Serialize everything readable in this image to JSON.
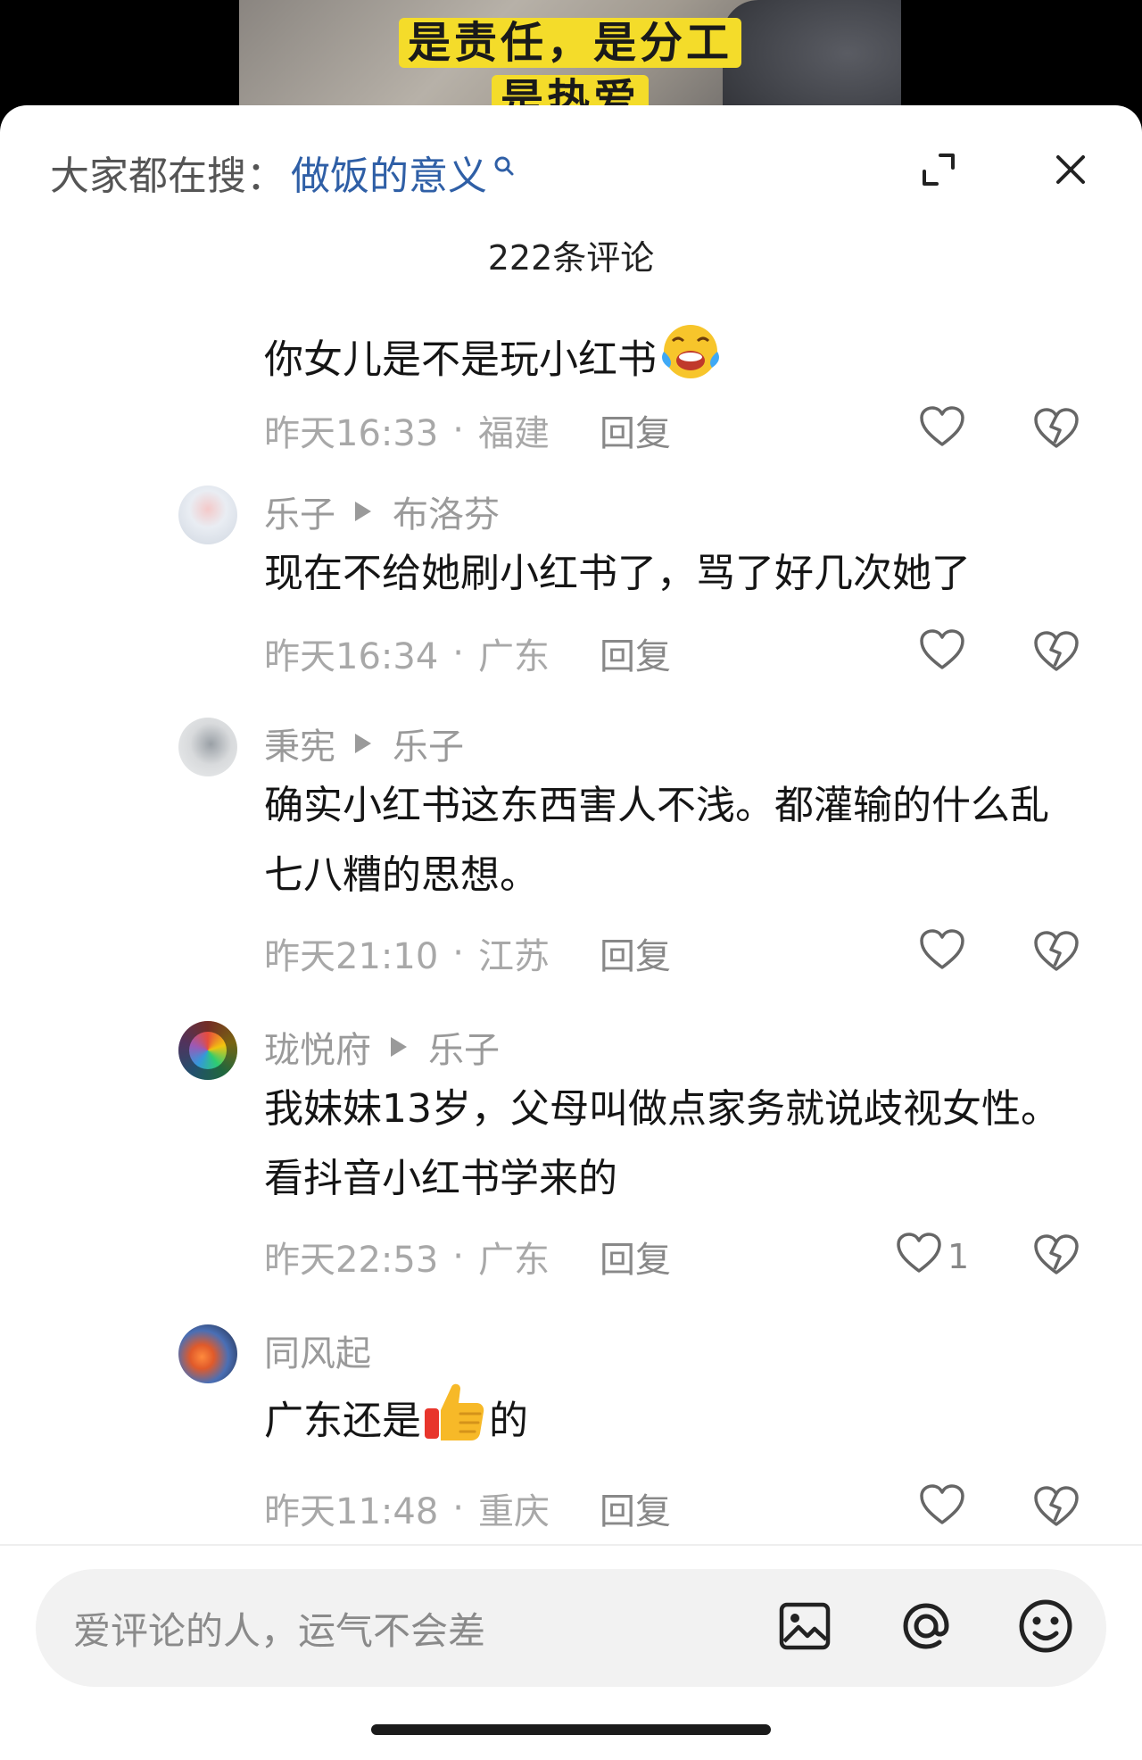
{
  "video": {
    "caption_line1": "是责任，是分工",
    "caption_line2": "是热爱"
  },
  "header": {
    "search_prefix": "大家都在搜：",
    "search_term": "做饭的意义",
    "comment_count": "222条评论",
    "icons": [
      "search-icon",
      "expand-icon",
      "close-icon"
    ]
  },
  "comments": [
    {
      "text": "你女儿是不是玩小红书",
      "emoji": "laugh-cry-emoji",
      "time": "昨天16:33",
      "location": "福建",
      "reply": "回复",
      "likes": ""
    },
    {
      "author": "乐子",
      "reply_to": "布洛芬",
      "text": "现在不给她刷小红书了，骂了好几次她了",
      "time": "昨天16:34",
      "location": "广东",
      "reply": "回复",
      "likes": ""
    },
    {
      "author": "秉宪",
      "reply_to": "乐子",
      "text": "确实小红书这东西害人不浅。都灌输的什么乱七八糟的思想。",
      "time": "昨天21:10",
      "location": "江苏",
      "reply": "回复",
      "likes": ""
    },
    {
      "author": "珑悦府",
      "reply_to": "乐子",
      "text": "我妹妹13岁，父母叫做点家务就说歧视女性。看抖音小红书学来的",
      "time": "昨天22:53",
      "location": "广东",
      "reply": "回复",
      "likes": "1"
    },
    {
      "author": "同风起",
      "text_before": "广东还是",
      "emoji": "thumbs-up-emoji",
      "text_after": "的",
      "time": "昨天11:48",
      "location": "重庆",
      "reply": "回复",
      "likes": ""
    }
  ],
  "input": {
    "placeholder": "爱评论的人，运气不会差",
    "icons": [
      "image-icon",
      "at-icon",
      "emoji-icon"
    ]
  },
  "colors": {
    "link": "#2f5fa6",
    "meta_text": "#a8a8a8",
    "caption_bg": "#f4dc2a"
  }
}
